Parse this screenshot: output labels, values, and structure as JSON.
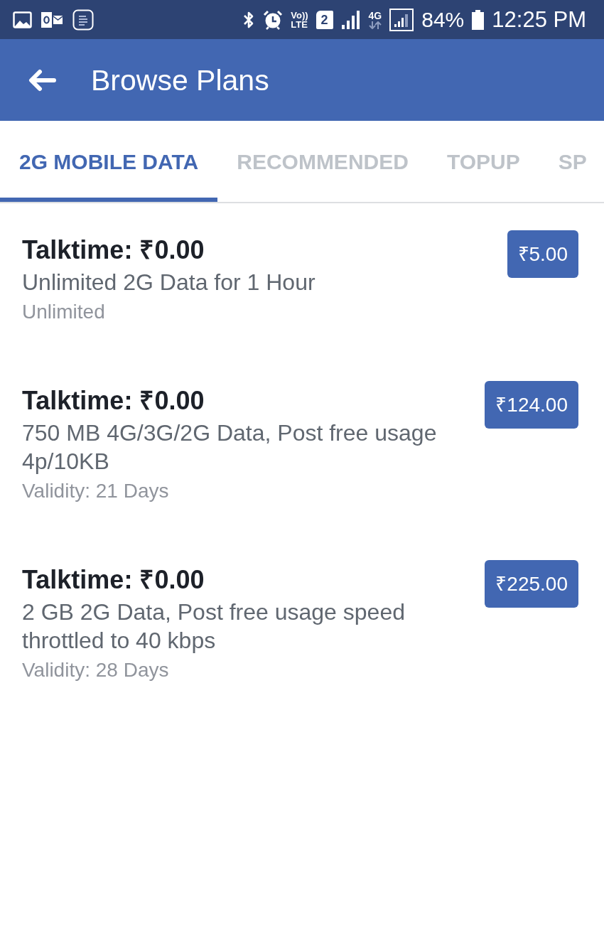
{
  "status_bar": {
    "volte": [
      "Vo))",
      "LTE"
    ],
    "sim_slot": "2",
    "network_type": "4G",
    "battery": "84%",
    "time": "12:25 PM"
  },
  "app_bar": {
    "title": "Browse Plans"
  },
  "tabs": [
    {
      "label": "2G MOBILE DATA",
      "selected": true
    },
    {
      "label": "RECOMMENDED",
      "selected": false
    },
    {
      "label": "TOPUP",
      "selected": false
    },
    {
      "label": "SP",
      "selected": false
    }
  ],
  "plans": [
    {
      "talktime": "Talktime: ₹0.00",
      "description": "Unlimited 2G Data for 1 Hour",
      "validity": "Unlimited",
      "price": "₹5.00"
    },
    {
      "talktime": "Talktime: ₹0.00",
      "description": "750 MB 4G/3G/2G Data, Post free usage 4p/10KB",
      "validity": "Validity: 21 Days",
      "price": "₹124.00"
    },
    {
      "talktime": "Talktime: ₹0.00",
      "description": "2 GB 2G Data, Post free usage speed throttled to 40 kbps",
      "validity": "Validity: 28 Days",
      "price": "₹225.00"
    }
  ]
}
